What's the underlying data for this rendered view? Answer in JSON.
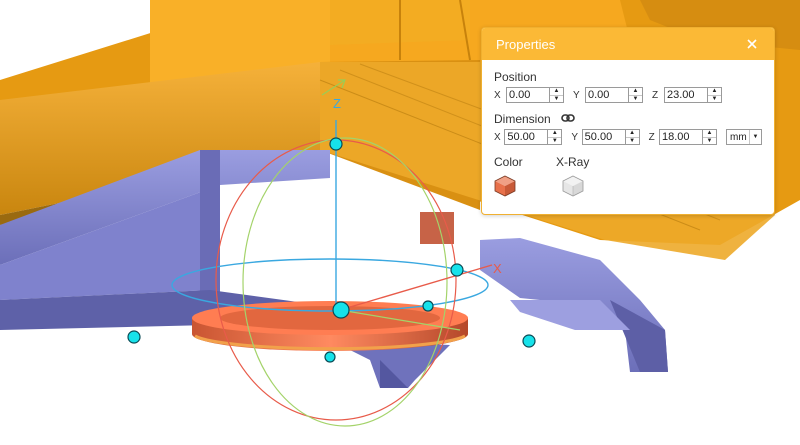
{
  "viewport": {
    "axis_labels": {
      "x": "X",
      "y": "Y",
      "z": "Z"
    },
    "colors": {
      "model": "#f6a81f",
      "support": "#8a8dd6",
      "selected": "#e8714b",
      "ring_z": "#3aa8e0",
      "ring_x": "#e85b4a",
      "ring_y": "#a4d36a",
      "handle": "#17e2ea"
    }
  },
  "properties": {
    "title": "Properties",
    "close_icon": "close-icon",
    "position": {
      "label": "Position",
      "x_label": "X",
      "x": "0.00",
      "y_label": "Y",
      "y": "0.00",
      "z_label": "Z",
      "z": "23.00"
    },
    "dimension": {
      "label": "Dimension",
      "link_icon": "link-icon",
      "x_label": "X",
      "x": "50.00",
      "y_label": "Y",
      "y": "50.00",
      "z_label": "Z",
      "z": "18.00",
      "unit": "mm"
    },
    "color": {
      "label": "Color",
      "value": "#e8714b"
    },
    "xray": {
      "label": "X-Ray"
    }
  }
}
